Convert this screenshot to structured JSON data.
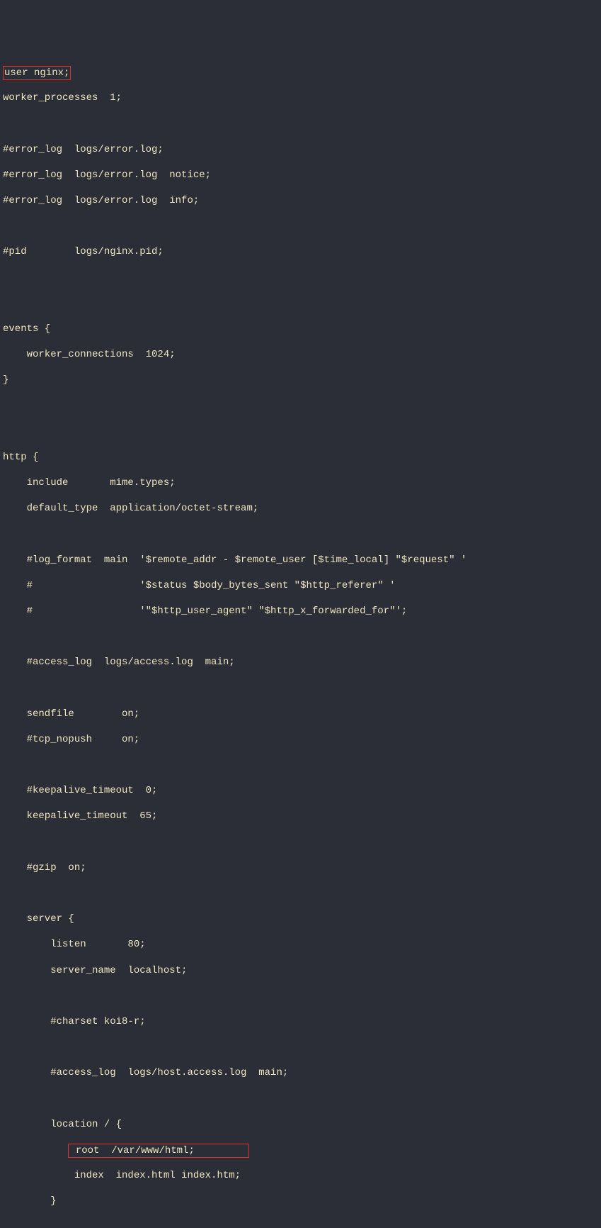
{
  "code": {
    "l1": "user nginx;",
    "l2": "worker_processes  1;",
    "l3": "",
    "l4": "#error_log  logs/error.log;",
    "l5": "#error_log  logs/error.log  notice;",
    "l6": "#error_log  logs/error.log  info;",
    "l7": "",
    "l8": "#pid        logs/nginx.pid;",
    "l9": "",
    "l10": "",
    "l11": "events {",
    "l12": "    worker_connections  1024;",
    "l13": "}",
    "l14": "",
    "l15": "",
    "l16": "http {",
    "l17": "    include       mime.types;",
    "l18": "    default_type  application/octet-stream;",
    "l19": "",
    "l20": "    #log_format  main  '$remote_addr - $remote_user [$time_local] \"$request\" '",
    "l21": "    #                  '$status $body_bytes_sent \"$http_referer\" '",
    "l22": "    #                  '\"$http_user_agent\" \"$http_x_forwarded_for\"';",
    "l23": "",
    "l24": "    #access_log  logs/access.log  main;",
    "l25": "",
    "l26": "    sendfile        on;",
    "l27": "    #tcp_nopush     on;",
    "l28": "",
    "l29": "    #keepalive_timeout  0;",
    "l30": "    keepalive_timeout  65;",
    "l31": "",
    "l32": "    #gzip  on;",
    "l33": "",
    "l34": "    server {",
    "l35": "        listen       80;",
    "l36": "        server_name  localhost;",
    "l37": "",
    "l38": "        #charset koi8-r;",
    "l39": "",
    "l40": "        #access_log  logs/host.access.log  main;",
    "l41": "",
    "l42": "        location / {",
    "l43_prefix": "           ",
    "l43_box": " root  /var/www/html;         ",
    "l44": "            index  index.html index.htm;",
    "l45": "        }"
  }
}
